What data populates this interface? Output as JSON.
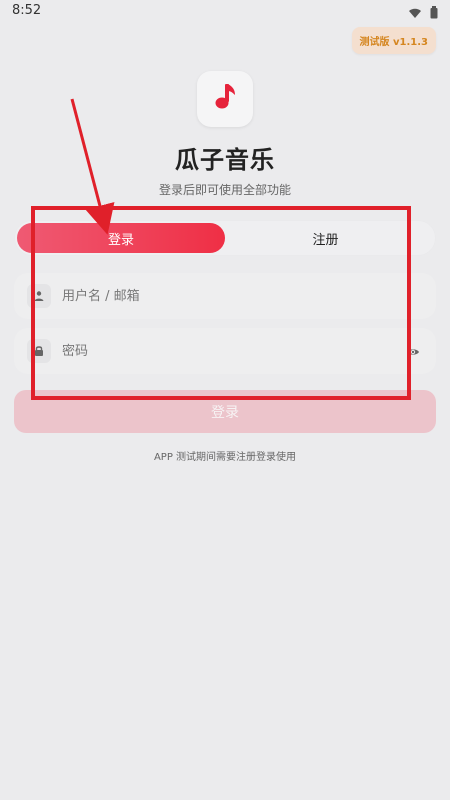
{
  "status_bar": {
    "time": "8:52"
  },
  "header": {
    "version_badge": "测试版 v1.1.3",
    "title": "瓜子音乐",
    "subtitle": "登录后即可使用全部功能"
  },
  "tabs": {
    "login_label": "登录",
    "register_label": "注册"
  },
  "form": {
    "username_placeholder": "用户名 / 邮箱",
    "password_placeholder": "密码"
  },
  "actions": {
    "login_button": "登录"
  },
  "footer": {
    "note": "APP 测试期间需要注册登录使用"
  },
  "colors": {
    "accent": "#ef2f45",
    "badge_bg": "#f4dfcf",
    "badge_text": "#d58620",
    "annotation": "#e0202a"
  },
  "icons": {
    "status": [
      "wifi-icon",
      "battery-icon"
    ],
    "logo": "music-note-icon",
    "username": "user-icon",
    "password": "lock-icon",
    "visibility": "eye-icon"
  }
}
